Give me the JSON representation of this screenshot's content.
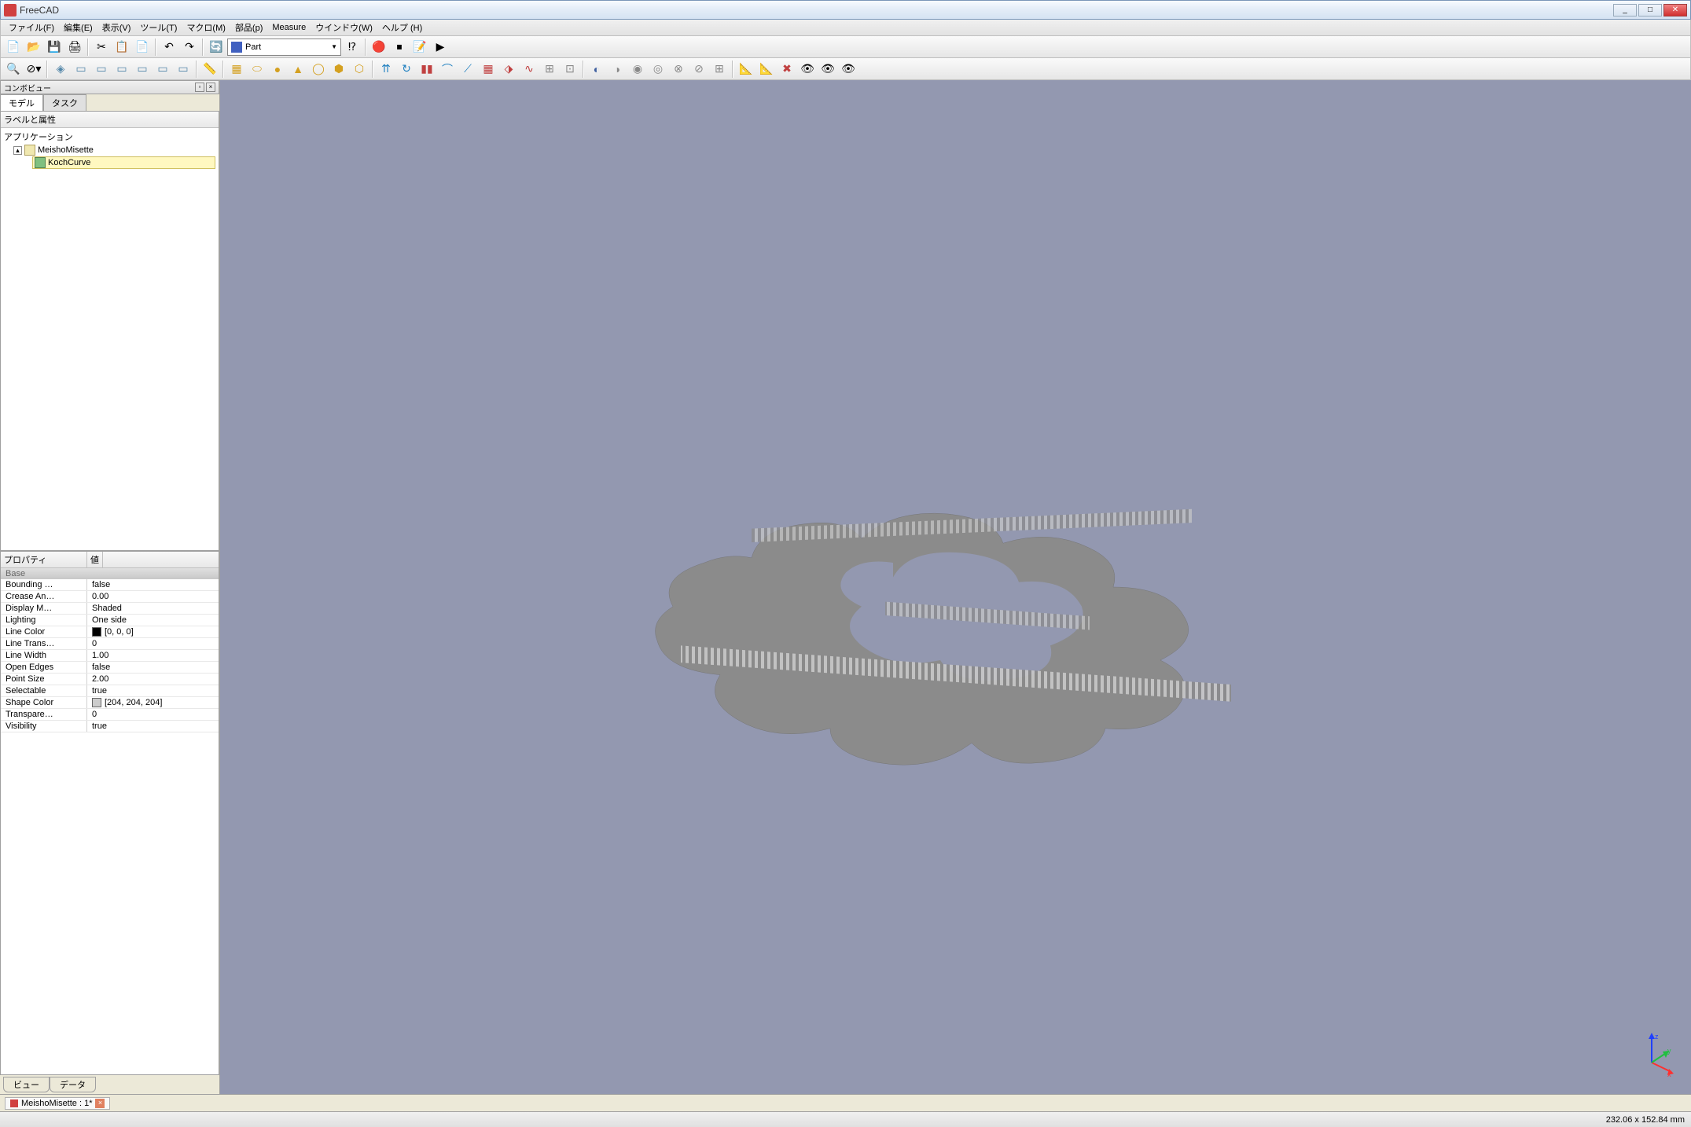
{
  "window": {
    "title": "FreeCAD"
  },
  "menu": {
    "file": "ファイル(F)",
    "edit": "編集(E)",
    "view": "表示(V)",
    "tools": "ツール(T)",
    "macro": "マクロ(M)",
    "part": "部品(p)",
    "measure": "Measure",
    "windows": "ウインドウ(W)",
    "help": "ヘルプ (H)"
  },
  "workbench_selector": {
    "label": "Part"
  },
  "dock": {
    "title": "コンボビュー"
  },
  "tabs": {
    "model": "モデル",
    "task": "タスク"
  },
  "tree": {
    "header": "ラベルと属性",
    "root": "アプリケーション",
    "doc": "MeishoMisette",
    "obj": "KochCurve"
  },
  "property_panel": {
    "col_prop": "プロパティ",
    "col_val": "値",
    "group": "Base",
    "rows": [
      {
        "k": "Bounding …",
        "v": "false"
      },
      {
        "k": "Crease An…",
        "v": "0.00"
      },
      {
        "k": "Display M…",
        "v": "Shaded"
      },
      {
        "k": "Lighting",
        "v": "One side"
      },
      {
        "k": "Line Color",
        "v": "[0, 0, 0]",
        "sw": "#000000"
      },
      {
        "k": "Line Trans…",
        "v": "0"
      },
      {
        "k": "Line Width",
        "v": "1.00"
      },
      {
        "k": "Open Edges",
        "v": "false"
      },
      {
        "k": "Point Size",
        "v": "2.00"
      },
      {
        "k": "Selectable",
        "v": "true"
      },
      {
        "k": "Shape Color",
        "v": "[204, 204, 204]",
        "sw": "#cccccc"
      },
      {
        "k": "Transpare…",
        "v": "0"
      },
      {
        "k": "Visibility",
        "v": "true"
      }
    ],
    "bottom_tabs": {
      "view": "ビュー",
      "data": "データ"
    }
  },
  "doc_tab": {
    "label": "MeishoMisette : 1*"
  },
  "status": {
    "dimensions": "232.06 x 152.84 mm"
  },
  "colors": {
    "viewport_bg": "#9398b0",
    "shape": "#8b8b8b"
  }
}
